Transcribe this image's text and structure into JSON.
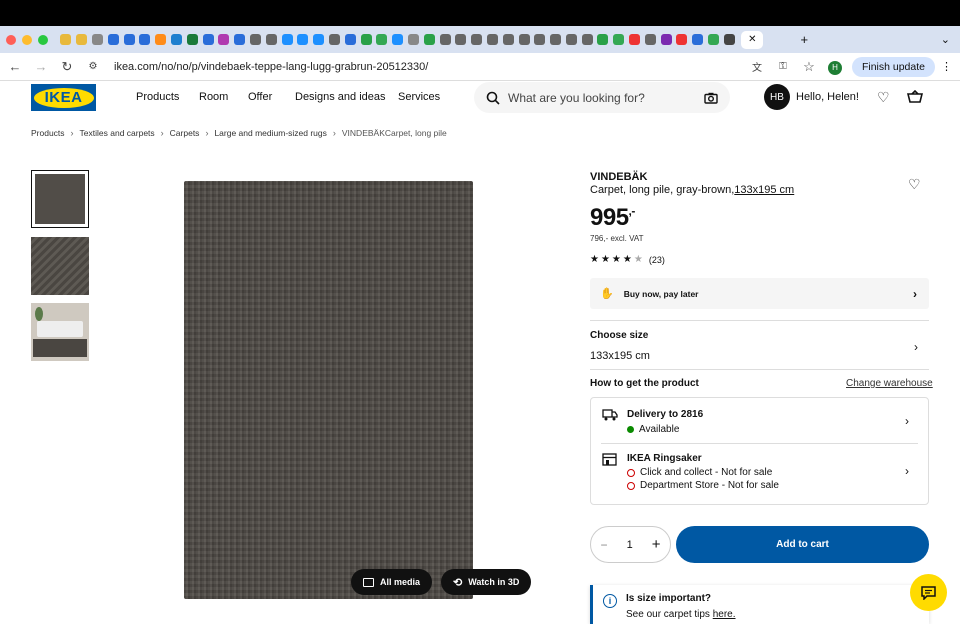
{
  "browser": {
    "url": "ikea.com/no/no/p/vindebaek-teppe-lang-lugg-grabrun-20512330/",
    "finish_update": "Finish update"
  },
  "header": {
    "logo_text": "IKEA",
    "menu": [
      "Products",
      "Room",
      "Offer",
      "Designs and ideas",
      "Services"
    ],
    "search_placeholder": "What are you looking for?",
    "avatar_initials": "HB",
    "greeting": "Hello, Helen!"
  },
  "breadcrumb": [
    "Products",
    "Textiles and carpets",
    "Carpets",
    "Large and medium-sized rugs",
    "VINDEBÄKCarpet, long pile"
  ],
  "media": {
    "all_media": "All media",
    "watch_3d": "Watch in 3D"
  },
  "product": {
    "name": "VINDEBÄK",
    "description": "Carpet, long pile, gray-brown,",
    "size_link": "133x195 cm",
    "price": "995",
    "price_suffix": ",-",
    "excl_vat": "796,- excl. VAT",
    "rating": 4.5,
    "review_count": "(23)",
    "bnpl": "Buy now, pay later"
  },
  "size": {
    "label": "Choose size",
    "value": "133x195 cm"
  },
  "availability": {
    "heading": "How to get the product",
    "change_warehouse": "Change warehouse",
    "delivery_title": "Delivery to 2816",
    "delivery_status": "Available",
    "store_title": "IKEA Ringsaker",
    "store_click": "Click and collect - Not for sale",
    "store_dept": "Department Store - Not for sale"
  },
  "cart": {
    "quantity": "1",
    "add_label": "Add to cart"
  },
  "tip": {
    "title": "Is size important?",
    "text": "See our carpet tips ",
    "link": "here."
  },
  "colors": {
    "ikea_blue": "#0058a3",
    "ikea_yellow": "#ffdb00"
  }
}
